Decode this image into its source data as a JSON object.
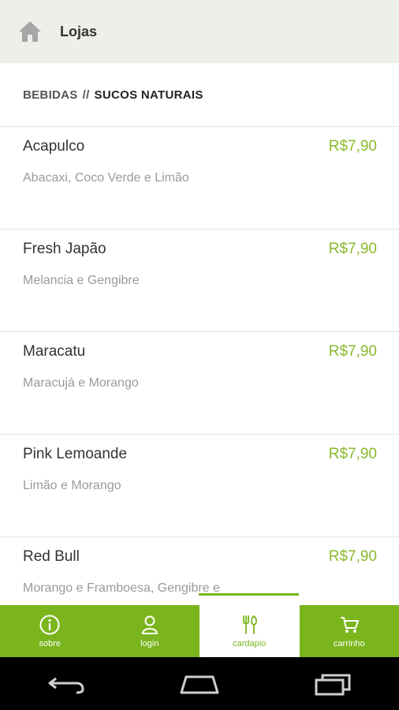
{
  "topbar": {
    "title": "Lojas",
    "icon": "home-icon"
  },
  "section": {
    "category": "BEBIDAS",
    "separator": "//",
    "subcategory": "SUCOS NATURAIS"
  },
  "items": [
    {
      "name": "Acapulco",
      "price": "R$7,90",
      "desc": "Abacaxi, Coco Verde e Limão"
    },
    {
      "name": "Fresh Japão",
      "price": "R$7,90",
      "desc": "Melancia e Gengibre"
    },
    {
      "name": "Maracatu",
      "price": "R$7,90",
      "desc": "Maracujá e Morango"
    },
    {
      "name": "Pink Lemoande",
      "price": "R$7,90",
      "desc": "Limão e Morango"
    },
    {
      "name": "Red Bull",
      "price": "R$7,90",
      "desc": "Morango e Framboesa, Gengibre e"
    }
  ],
  "nav": {
    "tabs": [
      {
        "label": "sobre",
        "icon": "info-icon"
      },
      {
        "label": "login",
        "icon": "user-icon"
      },
      {
        "label": "cardapio",
        "icon": "cutlery-icon"
      },
      {
        "label": "carrinho",
        "icon": "cart-icon"
      }
    ],
    "active_index": 2
  },
  "colors": {
    "accent": "#7ab51d",
    "price": "#8ab92d",
    "topbar_bg": "#eeeeea"
  }
}
